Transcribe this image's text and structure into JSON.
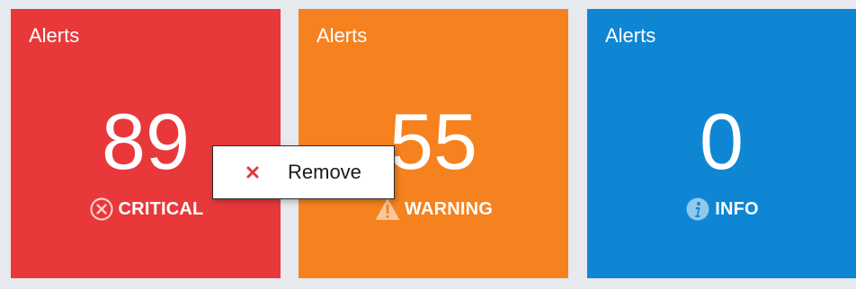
{
  "tiles": [
    {
      "id": "critical",
      "title": "Alerts",
      "count": "89",
      "status": "CRITICAL",
      "icon": "x-circle-icon",
      "color": "#e8383a"
    },
    {
      "id": "warning",
      "title": "Alerts",
      "count": "55",
      "status": "WARNING",
      "icon": "warning-triangle-icon",
      "color": "#f5821f"
    },
    {
      "id": "info",
      "title": "Alerts",
      "count": "0",
      "status": "INFO",
      "icon": "info-circle-icon",
      "color": "#0e86d4"
    }
  ],
  "context_menu": {
    "items": [
      {
        "label": "Remove",
        "icon": "close-icon",
        "icon_color": "#e0393b"
      }
    ]
  }
}
